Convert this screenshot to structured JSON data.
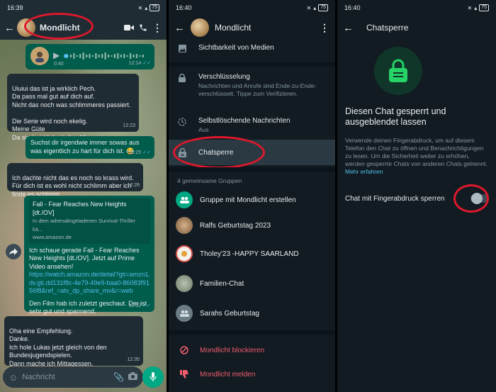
{
  "panel1": {
    "status": {
      "time": "16:39",
      "battery": "75"
    },
    "chat_name": "Mondlicht",
    "voice": {
      "duration": "0:40",
      "time": "12:14"
    },
    "messages": [
      {
        "text": "Uiuiui das ist ja wirklich Pech.\nDa pass mal gut auf dich auf.\nNicht das noch was schlimmeres passiert.\n\nDie Serie wird noch ekelig.\nMeine Güte\nDa sind wirklich ekelige Momente.",
        "time": "12:23"
      },
      {
        "text": "Suchst dir irgendwie immer sowas aus was eigentlich zu hart für dich ist. 😂",
        "time": "12:25"
      },
      {
        "text": "Ich dachte nicht das es noch so krass wird.\nFür dich ist es wohl nicht schlimm aber ich finde es schlimm.",
        "time": "12:26"
      },
      {
        "text": "Oha eine Empfehlung.\nDanke.\nIch hole Lukas jetzt gleich von den Bundesjugendspielen.\nDann mache ich Mittagessen.\nAlso vielleicht bis später",
        "time": "12:35"
      }
    ],
    "link_message": {
      "preview_title": "Fall - Fear Reaches New Heights [dt./OV]",
      "preview_desc": "In dem adrenalingeladenen Survival-Thriller kä...",
      "preview_domain": "www.amazon.de",
      "text": "Ich schaue gerade Fall - Fear Reaches New Heights [dt./OV]. Jetzt auf Prime Video ansehen!",
      "url": "https://watch.amazon.de/detail?gti=amzn1.dv.gti.dd131f8c-4e79-49e9-baa0-86083f9156f8&ref_=atv_dp_share_mv&r=web",
      "extra": "Den Film hab ich zuletzt geschaut.  Der ist sehr gut und spannend.",
      "time": "12:32"
    },
    "input_placeholder": "Nachricht"
  },
  "panel2": {
    "status": {
      "time": "16:40",
      "battery": "75"
    },
    "title": "Mondlicht",
    "items": [
      {
        "title": "Sichtbarkeit von Medien"
      },
      {
        "title": "Verschlüsselung",
        "subtitle": "Nachrichten und Anrufe sind Ende-zu-Ende-verschlüsselt. Tippe zum Verifizieren."
      },
      {
        "title": "Selbstlöschende Nachrichten",
        "subtitle": "Aus"
      },
      {
        "title": "Chatsperre"
      }
    ],
    "groups_label": "4 gemeinsame Gruppen",
    "create_group": "Gruppe mit Mondlicht erstellen",
    "groups": [
      "Ralfs Geburtstag 2023",
      "Tholey'23 -HAPPY SAARLAND",
      "Familien-Chat",
      "Sarahs Geburtstag"
    ],
    "block": "Mondlicht blockieren",
    "report": "Mondlicht melden"
  },
  "panel3": {
    "status": {
      "time": "16:40",
      "battery": "75"
    },
    "title": "Chatsperre",
    "heading": "Diesen Chat gesperrt und ausgeblendet lassen",
    "description": "Verwende deinen Fingerabdruck, um auf diesem Telefon den Chat zu öffnen und Benachrichtigungen zu lesen. Um die Sicherheit weiter zu erhöhen, werden gesperrte Chats von anderen Chats getrennt.",
    "more_link": "Mehr erfahren",
    "toggle_label": "Chat mit Fingerabdruck sperren",
    "toggle_on": false
  },
  "colors": {
    "accent": "#00a884",
    "highlight": "#e0182c",
    "danger": "#f15c6d",
    "link": "#53bdeb"
  }
}
